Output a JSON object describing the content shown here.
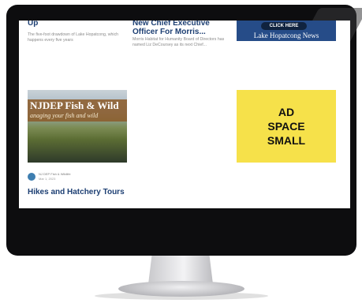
{
  "articles": [
    {
      "title": "Up",
      "excerpt": "The five-foot drawdown of Lake Hopatcong, which happens every five years"
    },
    {
      "title": "New Chief Executive Officer For Morris...",
      "excerpt": "Morris Habitat for Humanity Board of Directors has named Liz DeCoursey as its next Chief..."
    },
    {
      "title": "Hikes and Hatchery Tours",
      "image_title": "NJDEP Fish & Wild",
      "image_subtitle": "anaging your fish and wild",
      "author": "NJ DEP Fish & Wildlife",
      "date": "Mar 1, 2023"
    }
  ],
  "ads": {
    "click_here": "CLICK HERE",
    "logo_text": "Lake Hopatcong News",
    "ad_space": "AD\nSPACE\nSMALL"
  }
}
